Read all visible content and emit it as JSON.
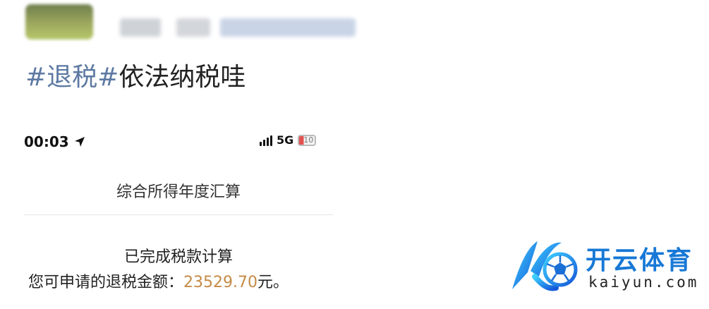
{
  "post": {
    "hashtag": "#退税#",
    "text": "依法纳税哇"
  },
  "status_bar": {
    "time": "00:03",
    "network": "5G",
    "battery": "10",
    "location_icon": "location-arrow-icon",
    "signal_icon": "signal-icon"
  },
  "app": {
    "title": "综合所得年度汇算"
  },
  "result": {
    "status": "已完成税款计算",
    "refund_label": "您可申请的退税金额：",
    "refund_amount": "23529.70",
    "refund_unit": "元。"
  },
  "watermark": {
    "name_cn": "开云体育",
    "name_en": "kaiyun.com"
  },
  "colors": {
    "hashtag": "#5d79a3",
    "amount": "#c58a45",
    "logo_blue": "#1778d6"
  }
}
